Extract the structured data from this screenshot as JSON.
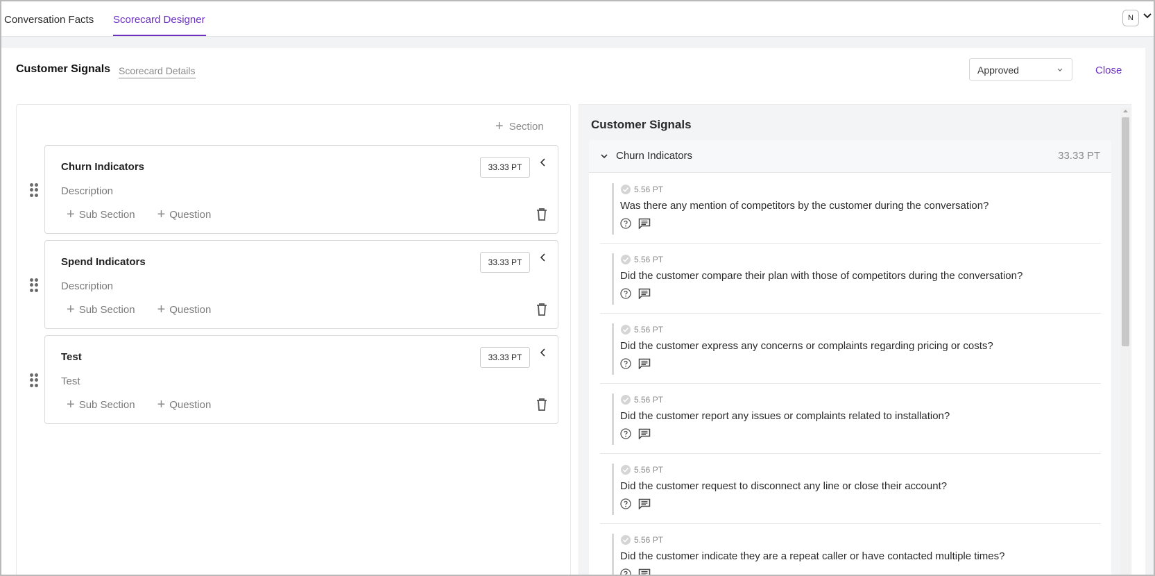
{
  "tabs": [
    {
      "label": "Conversation Facts",
      "active": false
    },
    {
      "label": "Scorecard Designer",
      "active": true
    }
  ],
  "user": {
    "avatar_initial": "N"
  },
  "header": {
    "title": "Customer Signals",
    "details_link": "Scorecard Details",
    "status_value": "Approved",
    "close_label": "Close"
  },
  "left": {
    "add_section_label": "Section",
    "sections": [
      {
        "name": "Churn Indicators",
        "description": "Description",
        "points": "33.33 PT",
        "sub_section_label": "Sub Section",
        "question_label": "Question"
      },
      {
        "name": "Spend Indicators",
        "description": "Description",
        "points": "33.33 PT",
        "sub_section_label": "Sub Section",
        "question_label": "Question"
      },
      {
        "name": "Test",
        "description": "Test",
        "points": "33.33 PT",
        "sub_section_label": "Sub Section",
        "question_label": "Question"
      }
    ]
  },
  "preview": {
    "title": "Customer Signals",
    "section": {
      "name": "Churn Indicators",
      "points": "33.33 PT"
    },
    "questions": [
      {
        "points": "5.56 PT",
        "text": "Was there any mention of competitors by the customer during the conversation?"
      },
      {
        "points": "5.56 PT",
        "text": "Did the customer compare their plan with those of competitors during the conversation?"
      },
      {
        "points": "5.56 PT",
        "text": "Did the customer express any concerns or complaints regarding pricing or costs?"
      },
      {
        "points": "5.56 PT",
        "text": "Did the customer report any issues or complaints related to installation?"
      },
      {
        "points": "5.56 PT",
        "text": "Did the customer request to disconnect any line or close their account?"
      },
      {
        "points": "5.56 PT",
        "text": "Did the customer indicate they are a repeat caller or have contacted multiple times?"
      }
    ]
  },
  "colors": {
    "accent": "#6b2fc2",
    "muted": "#8a8a8a"
  }
}
